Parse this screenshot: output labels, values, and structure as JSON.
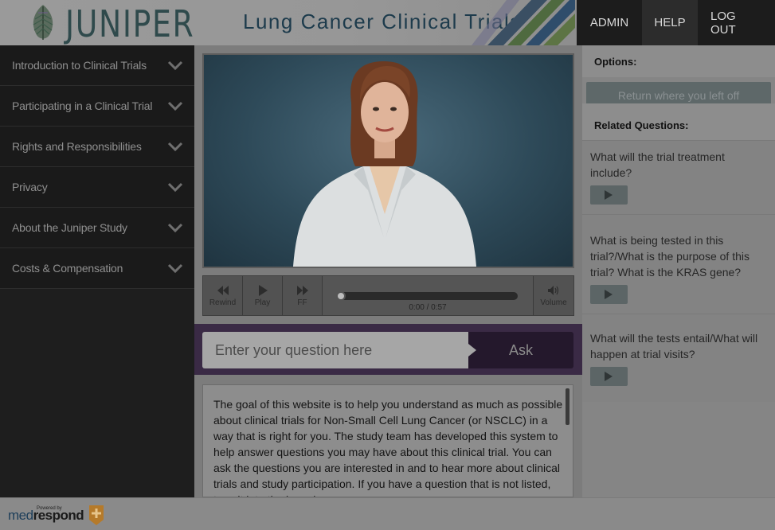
{
  "header": {
    "logo_text": "JUNIPER",
    "title": "Lung Cancer Clinical Trials",
    "nav": {
      "admin": "ADMIN",
      "help": "HELP",
      "logout": "LOG OUT"
    }
  },
  "sidebar": {
    "items": [
      {
        "label": "Introduction to Clinical Trials"
      },
      {
        "label": "Participating in a Clinical Trial"
      },
      {
        "label": "Rights and Responsibilities"
      },
      {
        "label": "Privacy"
      },
      {
        "label": "About the Juniper Study"
      },
      {
        "label": "Costs & Compensation"
      }
    ]
  },
  "player": {
    "rewind": "Rewind",
    "play": "Play",
    "ff": "FF",
    "volume": "Volume",
    "time": "0:00 / 0:57",
    "progress": 0
  },
  "ask": {
    "placeholder": "Enter your question here",
    "button": "Ask"
  },
  "info": {
    "text": "The goal of this website is to help you understand as much as possible about clinical trials for Non-Small Cell Lung Cancer (or NSCLC) in a way that is right for you. The study team has developed this system to help answer questions you may have about this clinical trial. You can ask the questions you are interested in and to hear more about clinical trials and study participation. If you have a question that is not listed, type it into the box above."
  },
  "right": {
    "options_heading": "Options:",
    "return_button": "Return where you left off",
    "related_heading": "Related Questions:",
    "questions": [
      {
        "text": "What will the trial treatment include?"
      },
      {
        "text": "What is being tested in this trial?/What is the purpose of this trial? What is the KRAS gene?"
      },
      {
        "text": "What will the tests entail/What will happen at trial visits?"
      }
    ]
  },
  "footer": {
    "powered_by": "Powered by",
    "brand_light": "med",
    "brand_bold": "respond"
  },
  "colors": {
    "ask_bar": "#3a2a45",
    "ask_button": "#24182c",
    "sidebar_bg": "#1a1a1a",
    "title_color": "#1d3b4c"
  }
}
